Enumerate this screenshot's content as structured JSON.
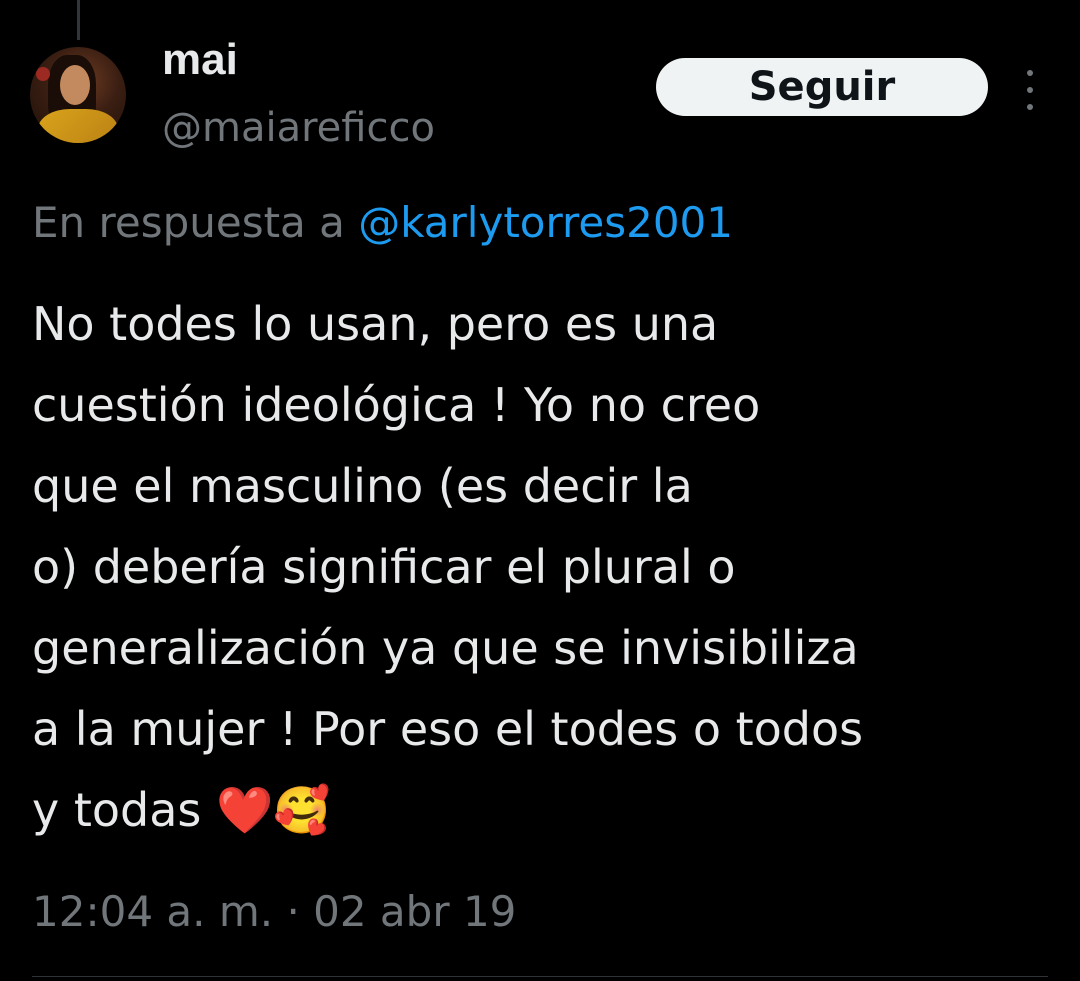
{
  "user": {
    "display_name": "mai",
    "handle": "@maiareficco"
  },
  "follow_button": {
    "label": "Seguir"
  },
  "reply": {
    "prefix": "En respuesta a ",
    "mention": "@karlytorres2001"
  },
  "tweet": {
    "lines": [
      "No todes lo usan, pero es una",
      "cuestión ideológica ! Yo no creo",
      "que el masculino (es decir la",
      "o) debería significar el plural o",
      "generalización ya que se invisibiliza",
      "a la mujer ! Por eso el todes o todos",
      "y todas ❤️🥰"
    ]
  },
  "timestamp": "12:04 a. m. · 02 abr 19",
  "colors": {
    "background": "#000000",
    "primary_text": "#e7e9ea",
    "secondary_text": "#71767b",
    "mention": "#1d9bf0",
    "button_bg": "#eff3f4"
  },
  "icons": {
    "more": "more-vertical-icon"
  }
}
